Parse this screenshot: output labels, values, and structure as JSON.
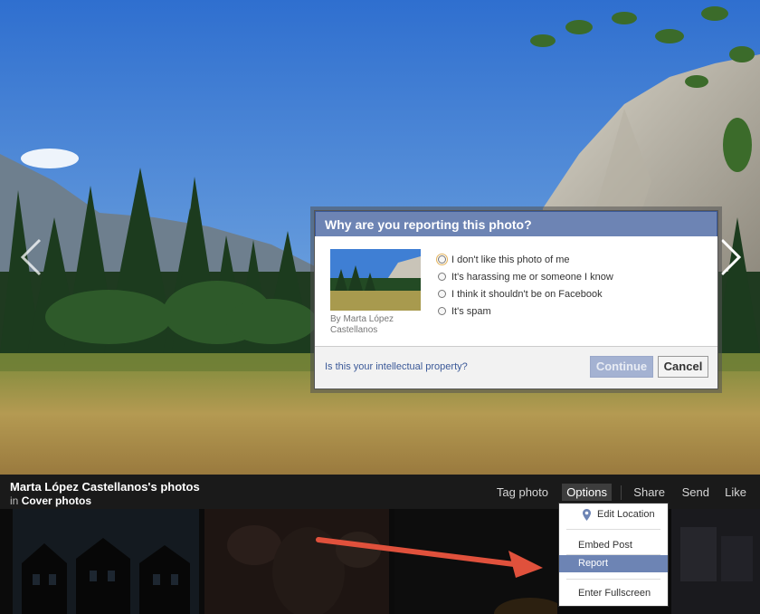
{
  "viewer": {
    "prev_icon": "chevron-left-icon",
    "next_icon": "chevron-right-icon"
  },
  "dialog": {
    "title": "Why are you reporting this photo?",
    "thumb_credit": "By Marta López Castellanos",
    "reasons": [
      "I don't like this photo of me",
      "It's harassing me or someone I know",
      "I think it shouldn't be on Facebook",
      "It's spam"
    ],
    "ip_link": "Is this your intellectual property?",
    "continue_label": "Continue",
    "cancel_label": "Cancel"
  },
  "caption": {
    "owner": "Marta López Castellanos's photos",
    "album_prefix": "in",
    "album": "Cover photos"
  },
  "actions": {
    "tag_photo": "Tag photo",
    "options": "Options",
    "share": "Share",
    "send": "Send",
    "like": "Like"
  },
  "options_menu": {
    "edit_location": "Edit Location",
    "embed_post": "Embed Post",
    "report": "Report",
    "enter_fullscreen": "Enter Fullscreen",
    "selected": "Report",
    "location_icon": "map-pin-icon"
  },
  "colors": {
    "dialog_header": "#6d84b4",
    "link": "#3b5998",
    "menu_highlight": "#6d84b4",
    "annotation_arrow": "#e0513c"
  }
}
